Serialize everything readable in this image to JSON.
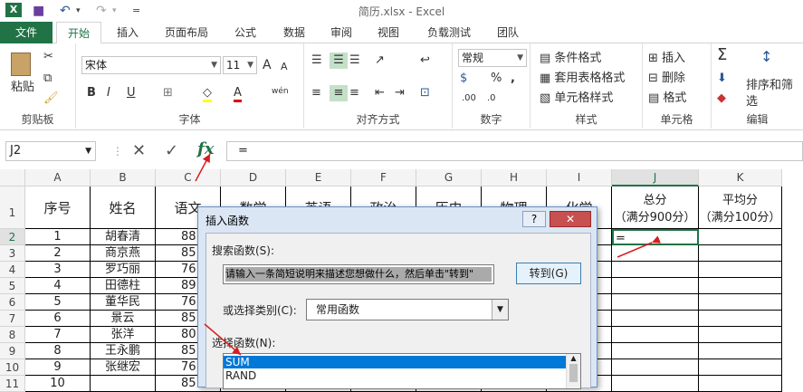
{
  "window": {
    "title": "简历.xlsx - Excel"
  },
  "quick_access": {
    "logo": "X",
    "save_icon": "💾",
    "undo": "↶",
    "undo_drop": "▾",
    "redo": "↷",
    "redo_drop": "▾",
    "customize": "="
  },
  "tabs": [
    "文件",
    "开始",
    "插入",
    "页面布局",
    "公式",
    "数据",
    "审阅",
    "视图",
    "负载测试",
    "团队"
  ],
  "ribbon": {
    "clipboard": {
      "paste": "粘贴",
      "label": "剪贴板"
    },
    "font": {
      "name": "宋体",
      "size": "11",
      "bold": "B",
      "italic": "I",
      "underline": "U",
      "wen": "wén",
      "label": "字体",
      "grow": "A",
      "shrink": "A"
    },
    "alignment": {
      "label": "对齐方式"
    },
    "number": {
      "format": "常规",
      "percent": "%",
      "comma": ",",
      "label": "数字"
    },
    "styles": {
      "conditional": "条件格式",
      "table": "套用表格格式",
      "cell": "单元格样式",
      "label": "样式"
    },
    "cells": {
      "insert": "插入",
      "delete": "删除",
      "format": "格式",
      "label": "单元格"
    },
    "editing": {
      "sum": "Σ",
      "sort": "排序和筛选",
      "label": "编辑"
    }
  },
  "formula_bar": {
    "name_box": "J2",
    "fx": "fx",
    "cancel": "✕",
    "enter": "✓",
    "value": "="
  },
  "columns": [
    "A",
    "B",
    "C",
    "D",
    "E",
    "F",
    "G",
    "H",
    "I",
    "J",
    "K"
  ],
  "rows": [
    "1",
    "2",
    "3",
    "4",
    "5",
    "6",
    "7",
    "8",
    "9",
    "10",
    "11"
  ],
  "header_row": [
    "序号",
    "姓名",
    "语文",
    "数学",
    "英语",
    "政治",
    "历史",
    "物理",
    "化学",
    "总分\n（满分900分）",
    "平均分\n（满分100分）"
  ],
  "data_rows": [
    [
      "1",
      "胡春清",
      "88"
    ],
    [
      "2",
      "商京燕",
      "85"
    ],
    [
      "3",
      "罗巧丽",
      "76"
    ],
    [
      "4",
      "田德柱",
      "89"
    ],
    [
      "5",
      "董华民",
      "76"
    ],
    [
      "6",
      "景云",
      "85"
    ],
    [
      "7",
      "张洋",
      "80"
    ],
    [
      "8",
      "王永鹏",
      "85"
    ],
    [
      "9",
      "张继宏",
      "76"
    ],
    [
      "10",
      "",
      "85"
    ]
  ],
  "j2_value": "=",
  "dialog": {
    "title": "插入函数",
    "help": "?",
    "close": "✕",
    "search_label": "搜索函数(S):",
    "search_value": "请输入一条简短说明来描述您想做什么，然后单击\"转到\"",
    "go_button": "转到(G)",
    "category_label": "或选择类别(C):",
    "category_value": "常用函数",
    "function_label": "选择函数(N):",
    "functions": [
      "SUM",
      "RAND"
    ]
  },
  "colors": {
    "accent": "#217346",
    "selection": "#0078d7",
    "arrow": "#d81e1e"
  }
}
